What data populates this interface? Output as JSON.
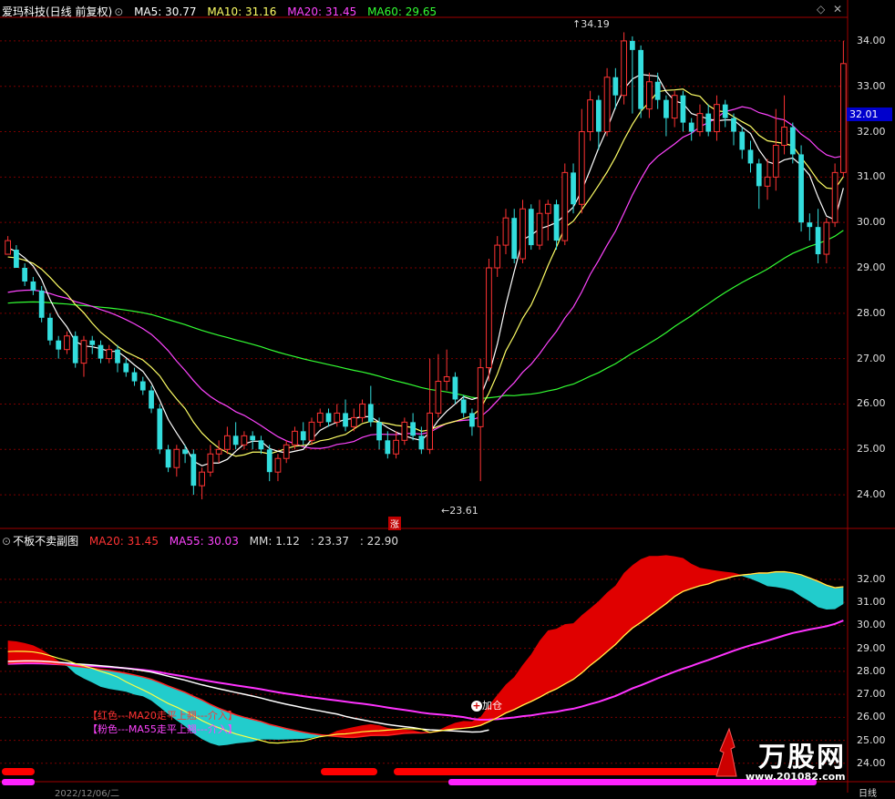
{
  "header": {
    "title": "爱玛科技(日线 前复权)",
    "ma": [
      {
        "label": "MA5: 30.77",
        "color": "#ffffff"
      },
      {
        "label": "MA10: 31.16",
        "color": "#ffff66"
      },
      {
        "label": "MA20: 31.45",
        "color": "#ff44ff"
      },
      {
        "label": "MA60: 29.65",
        "color": "#33ff33"
      }
    ]
  },
  "main_chart": {
    "high_label": "34.19",
    "low_label": "23.61",
    "rise_marker": "涨",
    "current_price": "32.01",
    "y_ticks": [
      "34.00",
      "33.00",
      "32.00",
      "31.00",
      "30.00",
      "29.00",
      "28.00",
      "27.00",
      "26.00",
      "25.00",
      "24.00"
    ]
  },
  "sub_chart": {
    "title": "不板不卖副图",
    "indicators": [
      {
        "label": "MA20: 31.45",
        "color": "#ff3333"
      },
      {
        "label": "MA55: 30.03",
        "color": "#ff44ff"
      },
      {
        "label": "MM: 1.12",
        "color": "#dddddd"
      },
      {
        "label": ": 23.37",
        "color": "#dddddd"
      },
      {
        "label": ": 22.90",
        "color": "#dddddd"
      }
    ],
    "y_ticks": [
      "32.00",
      "31.00",
      "30.00",
      "29.00",
      "28.00",
      "27.00",
      "26.00",
      "25.00",
      "24.00"
    ],
    "annotation_red": "【红色---MA20走平上翘---介入】",
    "annotation_pink": "【粉色---MA55走平上翘---介入】",
    "signal_label": "加仓"
  },
  "bottom": {
    "date": "2022/12/06/二",
    "axis_right": "日线"
  },
  "watermark": {
    "brand": "万股网",
    "url": "www.201082.com"
  },
  "chart_data": {
    "type": "candlestick",
    "ylim": [
      23.5,
      34.5
    ],
    "colors": {
      "up": "#ff3333",
      "down": "#33dddd",
      "ma5": "#ffffff",
      "ma10": "#ffff66",
      "ma20": "#ff44ff",
      "ma60": "#33ff33"
    },
    "candles": [
      [
        29.3,
        29.6,
        29.4,
        29.7
      ],
      [
        29.4,
        29.0,
        29.0,
        29.5
      ],
      [
        29.0,
        28.7,
        28.6,
        29.1
      ],
      [
        28.7,
        28.5,
        28.4,
        28.8
      ],
      [
        28.5,
        27.9,
        27.8,
        28.6
      ],
      [
        27.9,
        27.4,
        27.3,
        28.0
      ],
      [
        27.4,
        27.2,
        27.0,
        27.5
      ],
      [
        27.2,
        27.5,
        27.1,
        27.6
      ],
      [
        27.5,
        26.9,
        26.8,
        27.6
      ],
      [
        26.9,
        27.4,
        26.6,
        27.5
      ],
      [
        27.4,
        27.3,
        27.1,
        27.5
      ],
      [
        27.3,
        27.0,
        26.9,
        27.4
      ],
      [
        27.0,
        27.2,
        26.9,
        27.3
      ],
      [
        27.2,
        26.9,
        26.7,
        27.3
      ],
      [
        26.9,
        26.7,
        26.6,
        27.0
      ],
      [
        26.7,
        26.5,
        26.4,
        26.8
      ],
      [
        26.5,
        26.3,
        26.2,
        26.6
      ],
      [
        26.3,
        25.9,
        25.8,
        26.4
      ],
      [
        25.9,
        25.0,
        24.9,
        26.0
      ],
      [
        25.0,
        24.6,
        24.5,
        25.1
      ],
      [
        24.6,
        25.0,
        24.4,
        25.1
      ],
      [
        25.0,
        24.9,
        24.7,
        25.1
      ],
      [
        24.9,
        24.2,
        24.0,
        25.0
      ],
      [
        24.2,
        24.5,
        23.9,
        24.6
      ],
      [
        24.5,
        24.9,
        24.4,
        25.1
      ],
      [
        24.9,
        25.0,
        24.7,
        25.2
      ],
      [
        25.0,
        25.3,
        24.9,
        25.5
      ],
      [
        25.3,
        25.1,
        25.0,
        25.6
      ],
      [
        25.1,
        25.3,
        25.0,
        25.4
      ],
      [
        25.3,
        25.2,
        25.0,
        25.4
      ],
      [
        25.2,
        25.0,
        24.9,
        25.3
      ],
      [
        25.0,
        24.5,
        24.3,
        25.1
      ],
      [
        24.5,
        24.8,
        24.3,
        24.9
      ],
      [
        24.8,
        25.1,
        24.7,
        25.2
      ],
      [
        25.1,
        25.4,
        25.0,
        25.5
      ],
      [
        25.4,
        25.2,
        25.1,
        25.6
      ],
      [
        25.2,
        25.6,
        25.1,
        25.7
      ],
      [
        25.6,
        25.8,
        25.5,
        25.9
      ],
      [
        25.8,
        25.6,
        25.5,
        25.9
      ],
      [
        25.6,
        25.8,
        25.5,
        26.0
      ],
      [
        25.8,
        25.5,
        25.4,
        26.1
      ],
      [
        25.5,
        25.7,
        25.4,
        25.9
      ],
      [
        25.7,
        26.0,
        25.6,
        26.1
      ],
      [
        26.0,
        25.6,
        25.5,
        26.4
      ],
      [
        25.6,
        25.2,
        25.0,
        25.7
      ],
      [
        25.2,
        24.9,
        24.8,
        25.4
      ],
      [
        24.9,
        25.2,
        24.8,
        25.4
      ],
      [
        25.2,
        25.6,
        25.1,
        25.7
      ],
      [
        25.6,
        25.3,
        25.2,
        25.8
      ],
      [
        25.3,
        25.0,
        24.9,
        25.5
      ],
      [
        25.0,
        25.8,
        24.9,
        27.0
      ],
      [
        25.8,
        26.5,
        25.7,
        27.1
      ],
      [
        26.5,
        26.6,
        26.3,
        27.2
      ],
      [
        26.6,
        26.1,
        26.0,
        26.7
      ],
      [
        26.1,
        25.8,
        25.7,
        26.2
      ],
      [
        25.8,
        25.5,
        25.3,
        25.9
      ],
      [
        25.5,
        26.8,
        24.3,
        27.0
      ],
      [
        26.8,
        29.0,
        26.5,
        29.2
      ],
      [
        29.0,
        29.5,
        28.8,
        29.7
      ],
      [
        29.5,
        30.1,
        29.3,
        30.3
      ],
      [
        30.1,
        29.2,
        29.1,
        30.3
      ],
      [
        29.2,
        30.3,
        29.1,
        30.5
      ],
      [
        30.3,
        29.5,
        29.4,
        30.4
      ],
      [
        29.5,
        30.2,
        29.4,
        30.5
      ],
      [
        30.2,
        30.4,
        29.6,
        30.5
      ],
      [
        30.4,
        29.6,
        29.4,
        30.5
      ],
      [
        29.6,
        31.1,
        29.5,
        31.3
      ],
      [
        31.1,
        30.4,
        30.2,
        31.3
      ],
      [
        30.4,
        32.0,
        30.2,
        32.5
      ],
      [
        32.0,
        32.7,
        31.8,
        32.9
      ],
      [
        32.7,
        32.0,
        31.6,
        32.8
      ],
      [
        32.0,
        33.2,
        31.9,
        33.4
      ],
      [
        33.2,
        32.8,
        32.5,
        33.4
      ],
      [
        32.8,
        34.0,
        32.6,
        34.19
      ],
      [
        34.0,
        33.8,
        32.4,
        34.1
      ],
      [
        33.8,
        32.5,
        32.3,
        33.9
      ],
      [
        32.5,
        33.1,
        32.3,
        33.3
      ],
      [
        33.1,
        32.7,
        32.5,
        33.3
      ],
      [
        32.7,
        32.3,
        31.9,
        32.8
      ],
      [
        32.3,
        32.8,
        32.1,
        32.9
      ],
      [
        32.8,
        32.2,
        32.0,
        32.9
      ],
      [
        32.2,
        32.0,
        31.8,
        32.3
      ],
      [
        32.0,
        32.4,
        31.9,
        32.6
      ],
      [
        32.4,
        32.0,
        31.9,
        32.6
      ],
      [
        32.0,
        32.6,
        31.8,
        32.8
      ],
      [
        32.6,
        32.3,
        32.1,
        32.7
      ],
      [
        32.3,
        32.0,
        31.7,
        32.4
      ],
      [
        32.0,
        31.6,
        31.4,
        32.1
      ],
      [
        31.6,
        31.3,
        31.1,
        31.8
      ],
      [
        31.3,
        30.8,
        30.3,
        31.4
      ],
      [
        30.8,
        31.0,
        30.5,
        31.4
      ],
      [
        31.0,
        31.7,
        30.7,
        32.5
      ],
      [
        31.7,
        32.1,
        31.5,
        32.8
      ],
      [
        32.1,
        31.5,
        31.3,
        32.2
      ],
      [
        31.5,
        30.0,
        29.8,
        31.7
      ],
      [
        30.0,
        29.9,
        29.6,
        30.2
      ],
      [
        29.9,
        29.3,
        29.1,
        30.3
      ],
      [
        29.3,
        30.0,
        29.1,
        30.1
      ],
      [
        30.0,
        31.1,
        29.9,
        31.3
      ],
      [
        31.1,
        33.5,
        31.0,
        34.0
      ]
    ]
  }
}
